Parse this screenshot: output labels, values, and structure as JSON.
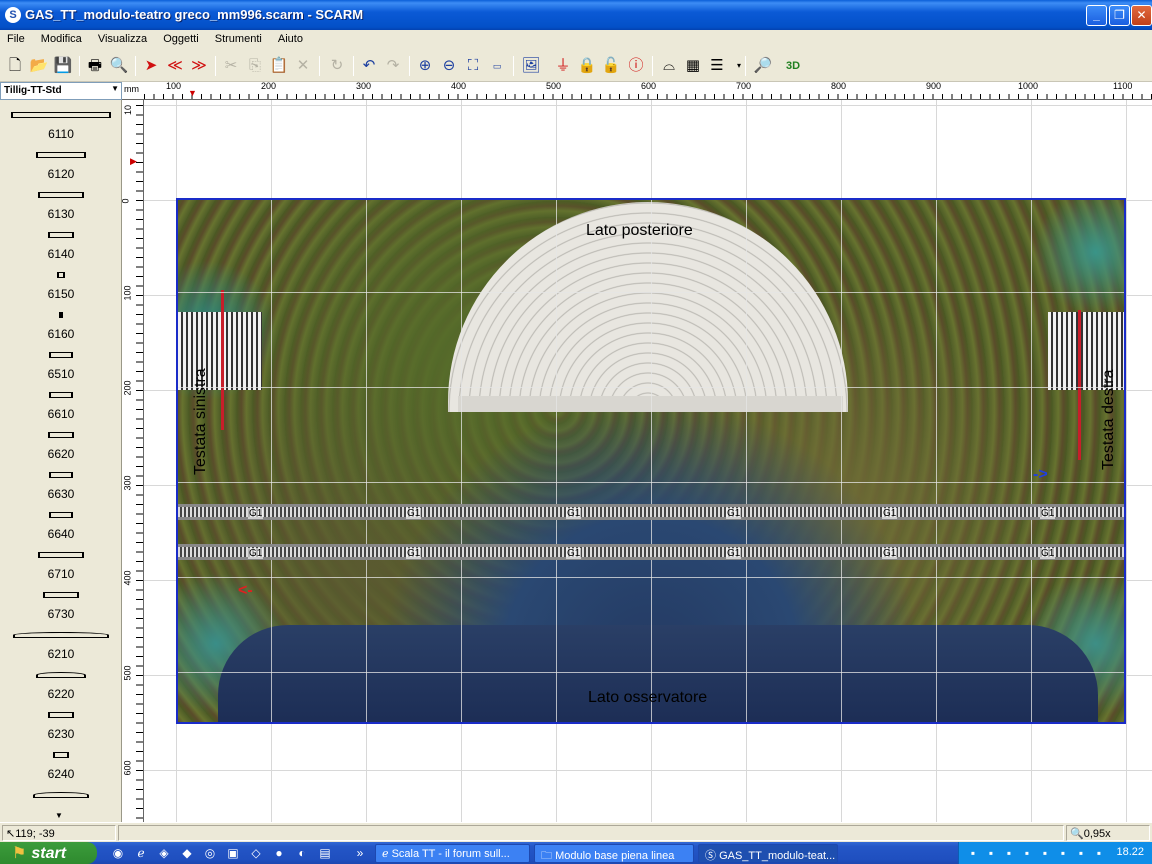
{
  "window": {
    "title": "GAS_TT_modulo-teatro greco_mm996.scarm - SCARM",
    "app_icon": "S",
    "minimize": "_",
    "maximize": "❐",
    "close": "✕"
  },
  "menu": [
    "File",
    "Modifica",
    "Visualizza",
    "Oggetti",
    "Strumenti",
    "Aiuto"
  ],
  "toolbar_icons": [
    "new-file-icon",
    "open-folder-icon",
    "save-icon",
    "print-icon",
    "print-preview-icon",
    "select-arrow-icon",
    "flip-left-icon",
    "flip-right-icon",
    "cut-icon",
    "copy-icon",
    "paste-icon",
    "delete-icon",
    "rotate-icon",
    "undo-icon",
    "redo-icon",
    "zoom-in-icon",
    "zoom-out-icon",
    "zoom-fit-icon",
    "zoom-1to1-icon",
    "background-image-icon",
    "pin-icon",
    "lock-icon",
    "unlock-icon",
    "info-icon",
    "bridge-icon",
    "flex-track-icon",
    "layers-icon",
    "search-icon",
    "3d-view-icon"
  ],
  "toolbar_3d_label": "3D",
  "library": {
    "selected": "Tillig-TT-Std",
    "items": [
      "6110",
      "6120",
      "6130",
      "6140",
      "6150",
      "6160",
      "6510",
      "6610",
      "6620",
      "6630",
      "6640",
      "6710",
      "6730",
      "6210",
      "6220",
      "6230",
      "6240"
    ]
  },
  "ruler": {
    "unit": "mm",
    "top_labels": [
      "100",
      "200",
      "300",
      "400",
      "500",
      "600",
      "700",
      "800",
      "900",
      "1000",
      "1100"
    ],
    "left_labels": [
      "10",
      "0",
      "100",
      "200",
      "300",
      "400",
      "500",
      "600"
    ]
  },
  "canvas": {
    "label_back": "Lato posteriore",
    "label_observer": "Lato osservatore",
    "label_left_head": "Testata sinistra",
    "label_right_head": "Testata destra",
    "arrow_left": "<-",
    "arrow_right": "->",
    "track_labels": [
      "G1",
      "G1",
      "G1",
      "G1",
      "G1",
      "G1"
    ]
  },
  "status": {
    "coords": "119; -39",
    "zoom": "0,95x"
  },
  "taskbar": {
    "start": "start",
    "tasks": [
      "Scala TT - il forum sull...",
      "Modulo base piena linea",
      "GAS_TT_modulo-teat..."
    ],
    "clock": "18.22"
  },
  "colors": {
    "module_border": "#1a2cc8",
    "track_marker": "#c81e2a",
    "arrow_left": "#e02020",
    "arrow_right": "#2040e0"
  }
}
